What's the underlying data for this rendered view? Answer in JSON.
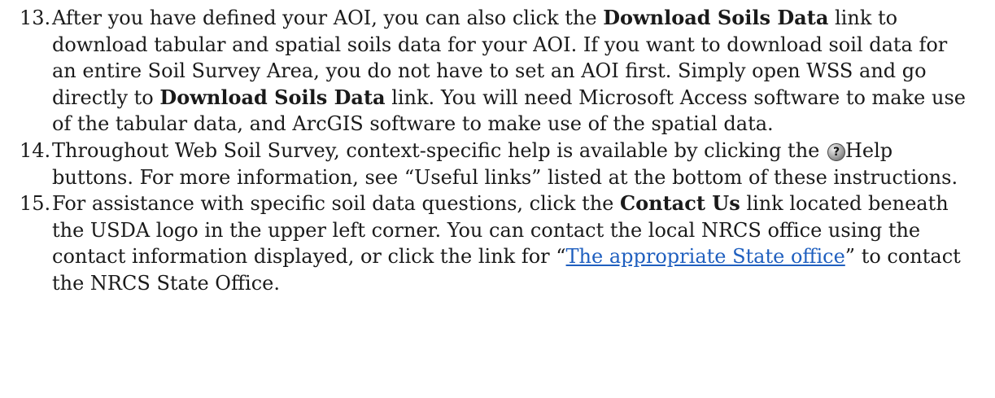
{
  "items": [
    {
      "number": "13.",
      "lines": [
        [
          "After you have defined your AOI, you can also click the ",
          "Download Soils Data",
          " link to"
        ],
        [
          "download tabular and spatial soils data for your AOI. If you want to download soil data for"
        ],
        [
          "an entire Soil Survey Area, you do not have to set an AOI first. Simply open WSS and go"
        ],
        [
          "directly to ",
          "Download Soils Data",
          " link. You will need Microsoft Access software to make use"
        ],
        [
          "of the tabular data, and ArcGIS software to make use of the spatial data."
        ]
      ]
    },
    {
      "number": "14.",
      "lines": [
        [
          "Throughout Web Soil Survey, context-specific help is available by clicking the ",
          "Help"
        ],
        [
          "buttons. For more information, see “Useful links” listed at the bottom of these instructions."
        ]
      ]
    },
    {
      "number": "15.",
      "lines": [
        [
          "For assistance with specific soil data questions, click the ",
          "Contact Us",
          " link located beneath"
        ],
        [
          "the USDA logo in the upper left corner. You can contact the local NRCS office using the"
        ],
        [
          "contact information displayed, or click the link for “",
          "The appropriate State office",
          "” to contact"
        ],
        [
          "the NRCS State Office."
        ]
      ]
    }
  ],
  "icons": {
    "help": "help-icon"
  },
  "colors": {
    "link": "#1f5fbf"
  }
}
